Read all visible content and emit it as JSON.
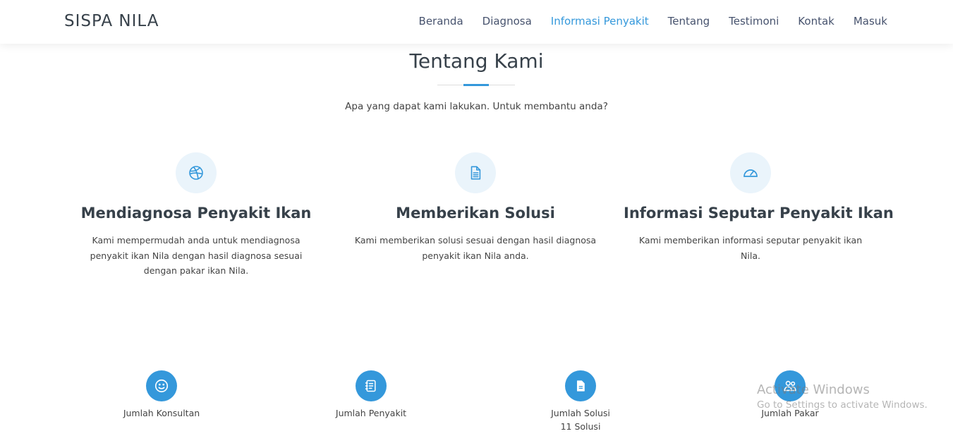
{
  "header": {
    "logo": "SISPA NILA",
    "nav": [
      "Beranda",
      "Diagnosa",
      "Informasi Penyakit",
      "Tentang",
      "Testimoni",
      "Kontak",
      "Masuk"
    ],
    "active_nav": "Informasi Penyakit"
  },
  "about": {
    "title": "Tentang Kami",
    "subtitle": "Apa yang dapat kami lakukan. Untuk membantu anda?"
  },
  "services": [
    {
      "icon": "dribbble-icon",
      "title": "Mendiagnosa Penyakit Ikan",
      "description": "Kami mempermudah anda untuk mendiagnosa penyakit ikan Nila dengan hasil diagnosa sesuai dengan pakar ikan Nila."
    },
    {
      "icon": "document-icon",
      "title": "Memberikan Solusi",
      "description": "Kami memberikan solusi sesuai dengan hasil diagnosa penyakit ikan Nila anda."
    },
    {
      "icon": "speedometer-icon",
      "title": "Informasi Seputar Penyakit Ikan",
      "description": "Kami memberikan informasi seputar penyakit ikan Nila."
    }
  ],
  "counters": [
    {
      "icon": "smiley-icon",
      "label": "Jumlah Konsultan",
      "value": ""
    },
    {
      "icon": "journal-icon",
      "label": "Jumlah Penyakit",
      "value": ""
    },
    {
      "icon": "document-icon",
      "label": "Jumlah Solusi",
      "value": "11 Solusi"
    },
    {
      "icon": "people-icon",
      "label": "Jumlah Pakar",
      "value": ""
    }
  ],
  "watermark": {
    "title": "Activate Windows",
    "subtitle": "Go to Settings to activate Windows."
  },
  "colors": {
    "accent": "#3498db",
    "heading": "#37414a",
    "icon_bg": "#eaf4fb"
  }
}
